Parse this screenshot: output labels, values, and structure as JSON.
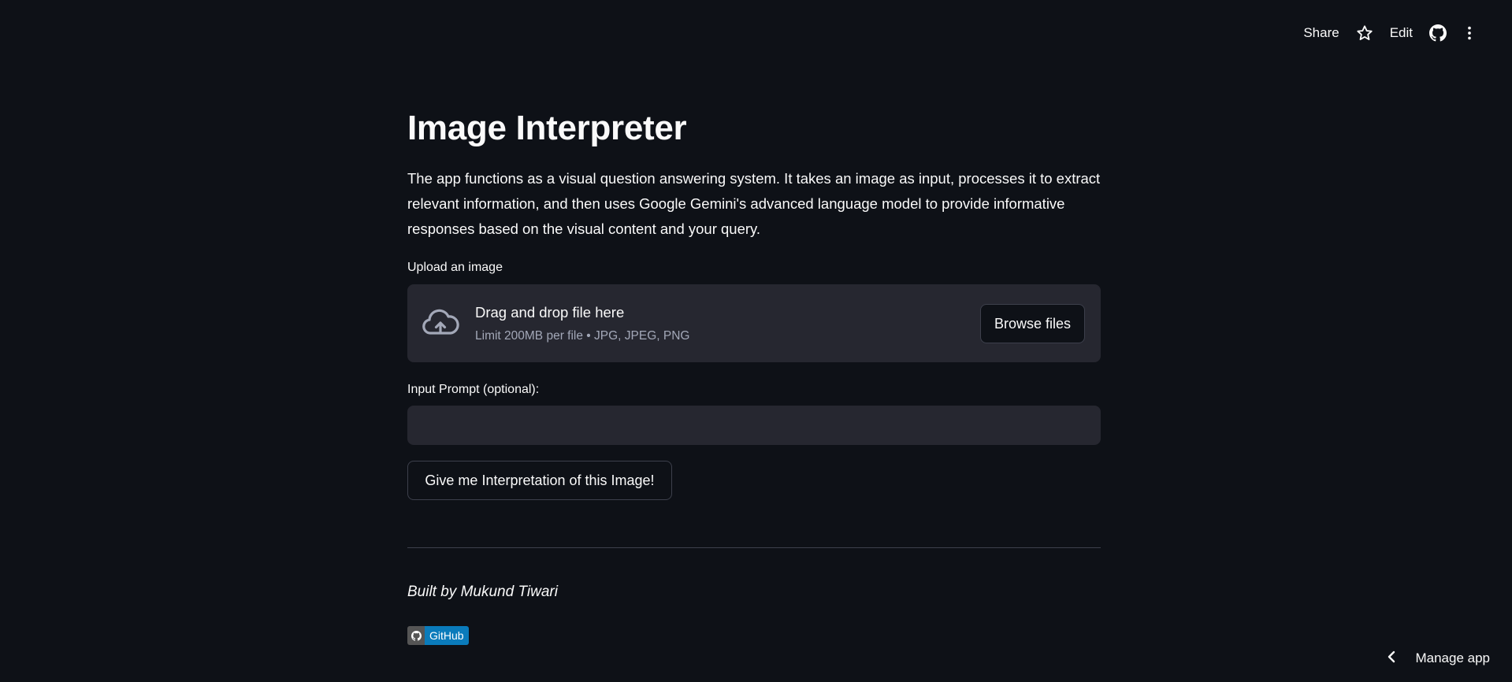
{
  "toolbar": {
    "share_label": "Share",
    "edit_label": "Edit",
    "icons": [
      "star-icon",
      "github-icon",
      "more-vertical-icon"
    ]
  },
  "page": {
    "title": "Image Interpreter",
    "description": "The app functions as a visual question answering system. It takes an image as input, processes it to extract relevant information, and then uses Google Gemini's advanced language model to provide informative responses based on the visual content and your query."
  },
  "uploader": {
    "label": "Upload an image",
    "drag_text": "Drag and drop file here",
    "limit_text": "Limit 200MB per file • JPG, JPEG, PNG",
    "browse_label": "Browse files",
    "icon": "cloud-upload-icon"
  },
  "prompt": {
    "label": "Input Prompt (optional):",
    "value": "",
    "placeholder": ""
  },
  "action_button": {
    "label": "Give me Interpretation of this Image!"
  },
  "footer": {
    "built_by": "Built by Mukund Tiwari",
    "badge_label": "GitHub",
    "badge_colors": {
      "left": "#555555",
      "right": "#0a7bbb"
    }
  },
  "manage_app": {
    "label": "Manage app",
    "icon": "chevron-left-icon"
  },
  "colors": {
    "background": "#0e1117",
    "surface": "#262730",
    "text": "#fafafa",
    "muted_text": "#a3a8b8",
    "border": "#3d404c"
  }
}
